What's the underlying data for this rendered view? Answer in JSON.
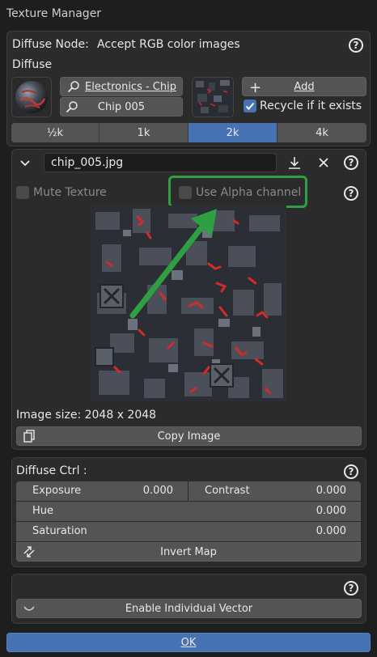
{
  "window": {
    "title": "Texture Manager"
  },
  "diffuse_node": {
    "label": "Diffuse Node:",
    "description": "Accept RGB color images",
    "section_label": "Diffuse",
    "material_search": "Electronics - Chip",
    "variant_search": "Chip 005",
    "add_label": "Add",
    "recycle_label": "Recycle if it exists",
    "recycle_checked": true
  },
  "resolution": {
    "options": [
      "½k",
      "1k",
      "2k",
      "4k"
    ],
    "selected": "2k"
  },
  "texture": {
    "filename": "chip_005.jpg",
    "mute_label": "Mute Texture",
    "alpha_label": "Use Alpha channel",
    "image_size": "Image size: 2048 x 2048",
    "copy_label": "Copy Image"
  },
  "diffuse_ctrl": {
    "title": "Diffuse Ctrl :",
    "exposure_label": "Exposure",
    "exposure_value": "0.000",
    "contrast_label": "Contrast",
    "contrast_value": "0.000",
    "hue_label": "Hue",
    "hue_value": "0.000",
    "saturation_label": "Saturation",
    "saturation_value": "0.000",
    "invert_label": "Invert Map"
  },
  "vector": {
    "enable_label": "Enable Individual Vector"
  },
  "footer": {
    "ok_label": "OK"
  },
  "colors": {
    "accent": "#4772b3",
    "highlight": "#2ea043",
    "background": "#1e1e1e",
    "panel": "#2b2b2b"
  },
  "icons": [
    "search-icon",
    "plus-icon",
    "checkbox-icon",
    "chevron-down-icon",
    "download-icon",
    "close-icon",
    "help-icon",
    "copy-icon",
    "swap-icon",
    "toggle-icon"
  ]
}
